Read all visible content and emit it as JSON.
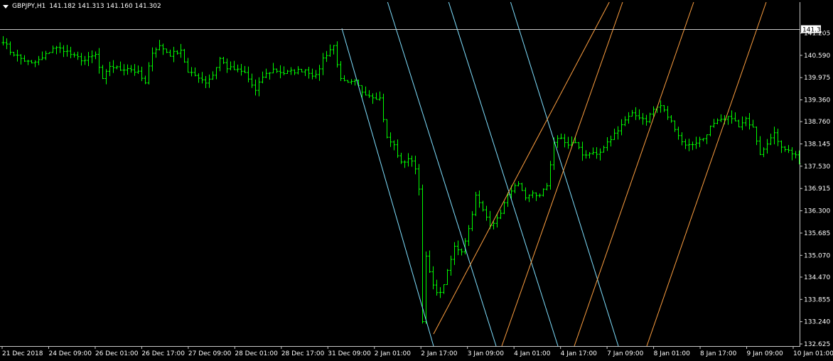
{
  "header": {
    "symbol": "GBPJPY,H1",
    "ohlc": "141.182 141.313 141.160 141.302"
  },
  "colors": {
    "background": "#000000",
    "bars": "#00ff00",
    "axis": "#c8c8c8",
    "fan_down": "#7fe0ff",
    "fan_up": "#ffa040",
    "price_line": "#c8c8c8"
  },
  "chart_data": {
    "type": "ohlc",
    "symbol": "GBPJPY",
    "timeframe": "H1",
    "ylim": [
      132.625,
      141.705
    ],
    "y_ticks": [
      "141.205",
      "140.590",
      "139.975",
      "139.360",
      "138.760",
      "138.145",
      "137.530",
      "136.915",
      "136.300",
      "135.685",
      "135.070",
      "134.470",
      "133.855",
      "133.240",
      "132.625"
    ],
    "x_ticks": [
      "21 Dec 2018",
      "24 Dec 09:00",
      "26 Dec 01:00",
      "26 Dec 17:00",
      "27 Dec 09:00",
      "28 Dec 01:00",
      "28 Dec 17:00",
      "31 Dec 09:00",
      "2 Jan 01:00",
      "2 Jan 17:00",
      "3 Jan 09:00",
      "4 Jan 01:00",
      "4 Jan 17:00",
      "7 Jan 09:00",
      "8 Jan 01:00",
      "8 Jan 17:00",
      "9 Jan 09:00",
      "10 Jan 01:00"
    ],
    "last_price": "141.302",
    "close_path": [
      [
        0,
        141.0
      ],
      [
        2,
        140.7
      ],
      [
        5,
        140.5
      ],
      [
        8,
        140.35
      ],
      [
        11,
        140.5
      ],
      [
        14,
        140.8
      ],
      [
        17,
        140.75
      ],
      [
        20,
        140.55
      ],
      [
        23,
        140.45
      ],
      [
        26,
        140.6
      ],
      [
        28,
        139.9
      ],
      [
        30,
        140.3
      ],
      [
        33,
        140.2
      ],
      [
        35,
        140.25
      ],
      [
        38,
        140.1
      ],
      [
        40,
        139.8
      ],
      [
        42,
        140.7
      ],
      [
        44,
        140.85
      ],
      [
        47,
        140.6
      ],
      [
        50,
        140.75
      ],
      [
        52,
        140.1
      ],
      [
        55,
        140.0
      ],
      [
        57,
        139.85
      ],
      [
        59,
        140.05
      ],
      [
        61,
        140.5
      ],
      [
        63,
        140.25
      ],
      [
        65,
        140.2
      ],
      [
        68,
        140.1
      ],
      [
        71,
        139.6
      ],
      [
        73,
        140.0
      ],
      [
        76,
        140.2
      ],
      [
        79,
        140.1
      ],
      [
        82,
        140.15
      ],
      [
        85,
        140.2
      ],
      [
        88,
        140.0
      ],
      [
        90,
        140.5
      ],
      [
        92,
        140.75
      ],
      [
        93,
        140.85
      ],
      [
        95,
        139.9
      ],
      [
        97,
        139.8
      ],
      [
        99,
        139.85
      ],
      [
        101,
        139.6
      ],
      [
        103,
        139.5
      ],
      [
        106,
        139.4
      ],
      [
        108,
        138.3
      ],
      [
        110,
        138.1
      ],
      [
        112,
        137.6
      ],
      [
        114,
        137.75
      ],
      [
        116,
        137.5
      ],
      [
        117,
        136.9
      ],
      [
        118,
        133.3
      ],
      [
        119,
        135.0
      ],
      [
        121,
        134.2
      ],
      [
        123,
        134.0
      ],
      [
        125,
        134.6
      ],
      [
        127,
        135.3
      ],
      [
        129,
        135.2
      ],
      [
        131,
        135.8
      ],
      [
        133,
        136.7
      ],
      [
        135,
        136.3
      ],
      [
        137,
        135.95
      ],
      [
        139,
        136.05
      ],
      [
        141,
        136.5
      ],
      [
        143,
        136.9
      ],
      [
        145,
        137.0
      ],
      [
        147,
        136.6
      ],
      [
        149,
        136.8
      ],
      [
        151,
        136.7
      ],
      [
        153,
        137.0
      ],
      [
        155,
        138.2
      ],
      [
        157,
        138.3
      ],
      [
        159,
        138.1
      ],
      [
        161,
        138.2
      ],
      [
        163,
        137.85
      ],
      [
        165,
        137.9
      ],
      [
        167,
        137.8
      ],
      [
        169,
        138.0
      ],
      [
        171,
        138.3
      ],
      [
        173,
        138.55
      ],
      [
        175,
        138.8
      ],
      [
        177,
        138.95
      ],
      [
        179,
        138.9
      ],
      [
        181,
        138.8
      ],
      [
        183,
        139.1
      ],
      [
        185,
        139.2
      ],
      [
        187,
        138.9
      ],
      [
        189,
        138.6
      ],
      [
        191,
        138.2
      ],
      [
        193,
        138.1
      ],
      [
        195,
        138.2
      ],
      [
        197,
        138.3
      ],
      [
        199,
        138.6
      ],
      [
        201,
        138.75
      ],
      [
        203,
        138.8
      ],
      [
        205,
        138.9
      ],
      [
        207,
        138.6
      ],
      [
        209,
        138.8
      ],
      [
        211,
        138.65
      ],
      [
        213,
        137.9
      ],
      [
        215,
        138.2
      ],
      [
        217,
        138.4
      ],
      [
        219,
        138.1
      ],
      [
        221,
        137.95
      ],
      [
        223,
        137.85
      ],
      [
        224,
        137.6
      ]
    ],
    "fan_lines": [
      {
        "color": "#7fe0ff",
        "direction": "down",
        "count": 4
      },
      {
        "color": "#ffa040",
        "direction": "up",
        "count": 4
      }
    ]
  }
}
